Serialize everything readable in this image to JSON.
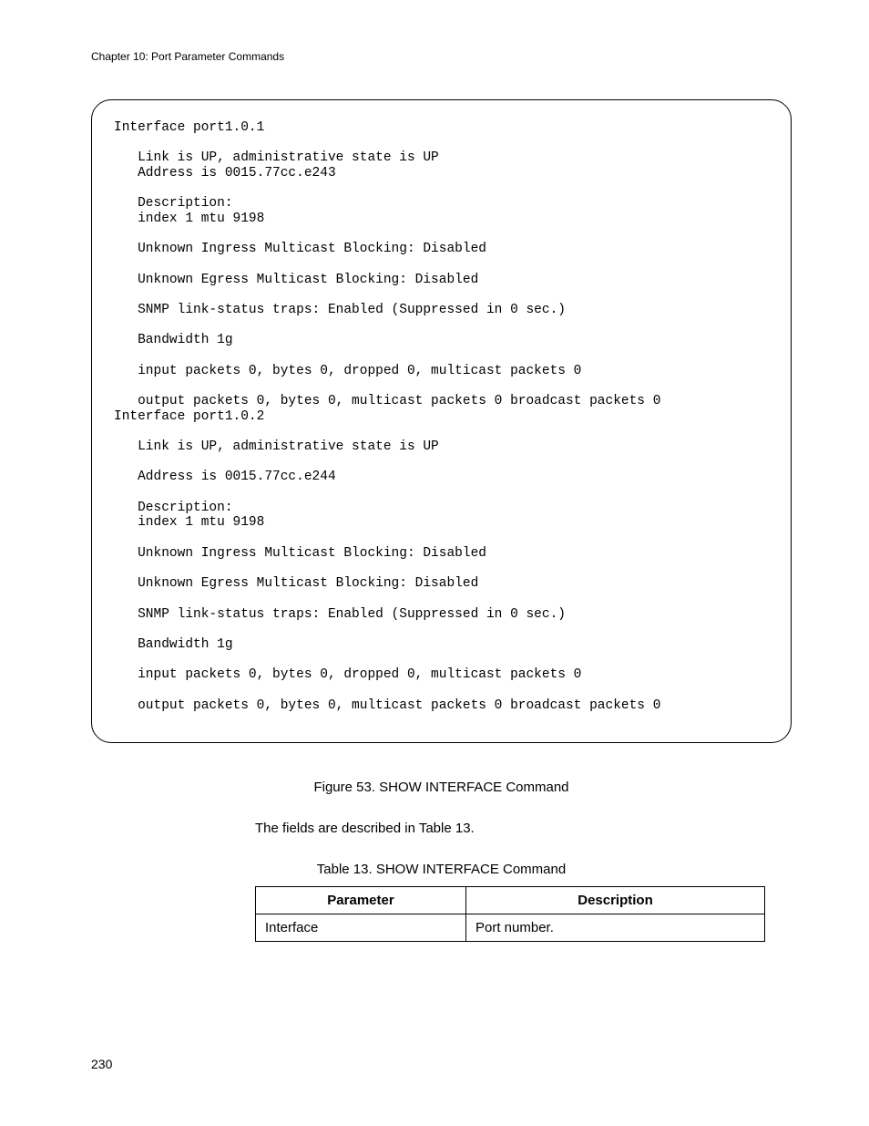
{
  "header": "Chapter 10: Port Parameter Commands",
  "code": "Interface port1.0.1\n\n   Link is UP, administrative state is UP\n   Address is 0015.77cc.e243\n\n   Description:\n   index 1 mtu 9198\n\n   Unknown Ingress Multicast Blocking: Disabled\n\n   Unknown Egress Multicast Blocking: Disabled\n\n   SNMP link-status traps: Enabled (Suppressed in 0 sec.)\n\n   Bandwidth 1g\n\n   input packets 0, bytes 0, dropped 0, multicast packets 0\n\n   output packets 0, bytes 0, multicast packets 0 broadcast packets 0\nInterface port1.0.2\n\n   Link is UP, administrative state is UP\n\n   Address is 0015.77cc.e244\n\n   Description:\n   index 1 mtu 9198\n\n   Unknown Ingress Multicast Blocking: Disabled\n\n   Unknown Egress Multicast Blocking: Disabled\n\n   SNMP link-status traps: Enabled (Suppressed in 0 sec.)\n\n   Bandwidth 1g\n\n   input packets 0, bytes 0, dropped 0, multicast packets 0\n\n   output packets 0, bytes 0, multicast packets 0 broadcast packets 0\n",
  "figure_caption": "Figure 53. SHOW INTERFACE Command",
  "body_text": "The fields are described in Table 13.",
  "table_caption": "Table 13. SHOW INTERFACE Command",
  "table": {
    "headers": {
      "param": "Parameter",
      "desc": "Description"
    },
    "rows": [
      {
        "param": "Interface",
        "desc": "Port number."
      }
    ]
  },
  "page_number": "230"
}
